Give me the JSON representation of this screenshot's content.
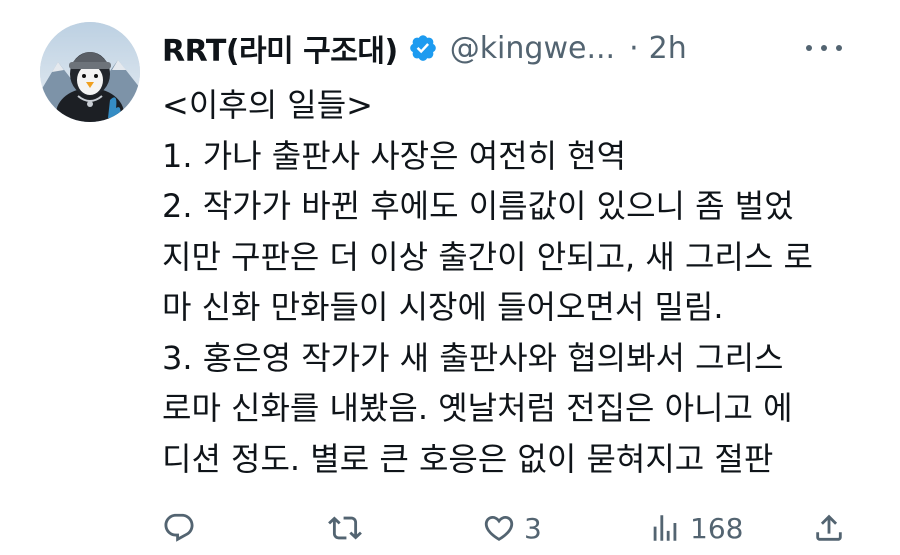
{
  "user": {
    "display_name": "RRT(라미 구조대)",
    "handle": "@kingwe...",
    "separator": "·",
    "time": "2h"
  },
  "tweet": {
    "lines": [
      "<이후의 일들>",
      "1. 가나 출판사 사장은 여전히 현역",
      "2. 작가가 바뀐 후에도 이름값이 있으니 좀 벌었",
      "지만 구판은 더 이상 출간이 안되고, 새 그리스 로",
      "마 신화 만화들이 시장에 들어오면서 밀림.",
      "3. 홍은영 작가가 새 출판사와 협의봐서 그리스",
      "로마 신화를 내봤음. 옛날처럼 전집은 아니고 에",
      "디션 정도. 별로 큰 호응은 없이 묻혀지고 절판"
    ]
  },
  "actions": {
    "reply_count": "",
    "repost_count": "",
    "like_count": "3",
    "views_count": "168"
  },
  "icons": {
    "verified": "verified-badge-icon",
    "more": "more-options-icon",
    "reply": "reply-icon",
    "repost": "repost-icon",
    "like": "like-icon",
    "views": "views-icon",
    "share": "share-icon"
  },
  "colors": {
    "text": "#0f1419",
    "secondary": "#536471",
    "verified": "#1d9bf0",
    "background": "#ffffff"
  }
}
